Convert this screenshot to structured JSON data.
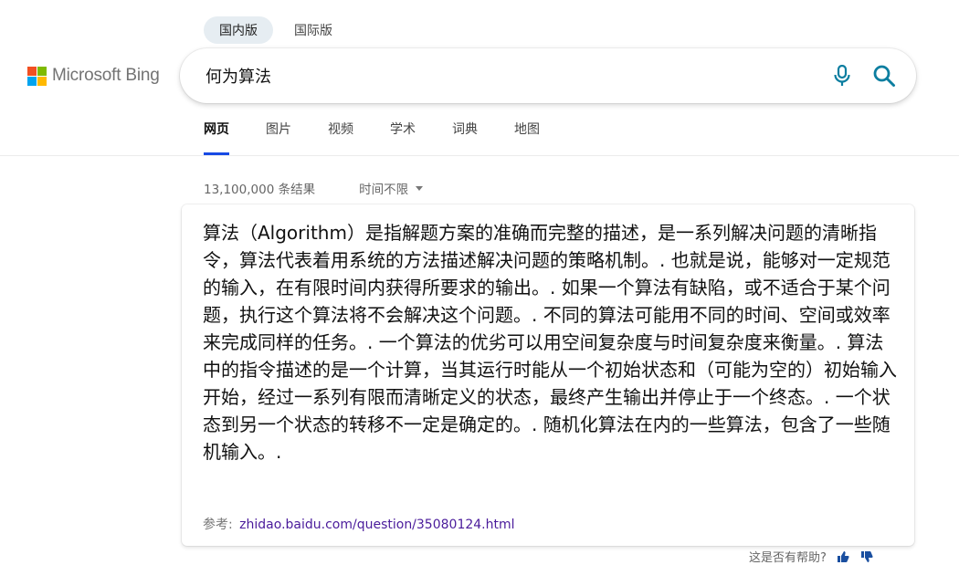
{
  "region_toggle": {
    "domestic": "国内版",
    "international": "国际版"
  },
  "logo": {
    "wordmark": "Microsoft Bing"
  },
  "search": {
    "query": "何为算法"
  },
  "tabs": [
    {
      "label": "网页",
      "active": true
    },
    {
      "label": "图片"
    },
    {
      "label": "视频"
    },
    {
      "label": "学术"
    },
    {
      "label": "词典"
    },
    {
      "label": "地图"
    }
  ],
  "results": {
    "count_text": "13,100,000 条结果",
    "time_filter": "时间不限"
  },
  "answer": {
    "text": "算法（Algorithm）是指解题方案的准确而完整的描述，是一系列解决问题的清晰指令，算法代表着用系统的方法描述解决问题的策略机制。. 也就是说，能够对一定规范的输入，在有限时间内获得所要求的输出。. 如果一个算法有缺陷，或不适合于某个问题，执行这个算法将不会解决这个问题。. 不同的算法可能用不同的时间、空间或效率来完成同样的任务。. 一个算法的优劣可以用空间复杂度与时间复杂度来衡量。. 算法中的指令描述的是一个计算，当其运行时能从一个初始状态和（可能为空的）初始输入开始，经过一系列有限而清晰定义的状态，最终产生输出并停止于一个终态。. 一个状态到另一个状态的转移不一定是确定的。. 随机化算法在内的一些算法，包含了一些随机输入。.",
    "source_label": "参考:",
    "source_link": "zhidao.baidu.com/question/35080124.html"
  },
  "feedback": {
    "prompt": "这是否有帮助?"
  },
  "colors": {
    "logo_red": "#f25022",
    "logo_green": "#7fba00",
    "logo_blue": "#00a4ef",
    "logo_yellow": "#ffb900",
    "mic": "#0c7ea0",
    "search_icon": "#0c7ea0",
    "tab_underline": "#174ae4",
    "source_link": "#4a1b9b"
  },
  "icons": {
    "mic": "microphone-icon",
    "search": "magnifier-icon",
    "caret": "caret-down-icon",
    "thumbs_up": "thumbs-up-icon",
    "thumbs_down": "thumbs-down-icon"
  }
}
